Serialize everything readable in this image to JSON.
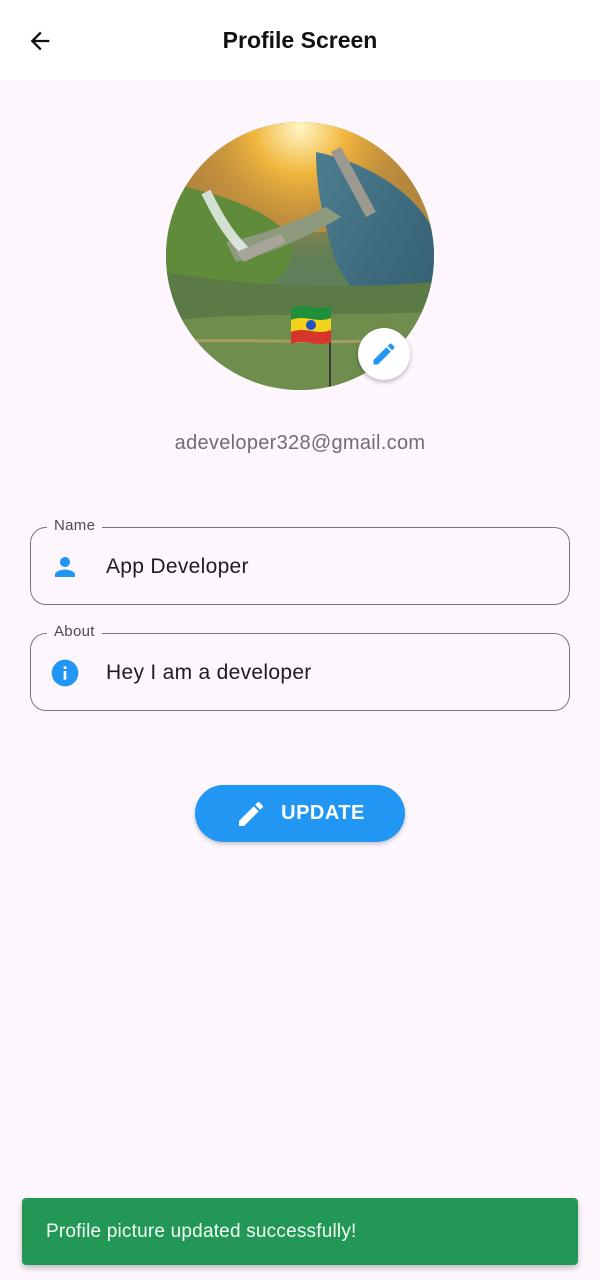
{
  "appbar": {
    "title": "Profile Screen",
    "back_icon": "arrow-left-icon"
  },
  "profile": {
    "avatar_description": "profile-photo",
    "edit_photo_icon": "pencil-icon",
    "email": "adeveloper328@gmail.com"
  },
  "form": {
    "name": {
      "label": "Name",
      "value": "App Developer",
      "icon": "person-icon"
    },
    "about": {
      "label": "About",
      "value": "Hey I am a developer",
      "icon": "info-icon"
    }
  },
  "update_button": {
    "label": "UPDATE",
    "icon": "pencil-icon"
  },
  "snackbar": {
    "message": "Profile picture updated successfully!"
  },
  "colors": {
    "accent": "#2196f3",
    "background": "#fdf7fd",
    "snackbar": "#229756"
  }
}
